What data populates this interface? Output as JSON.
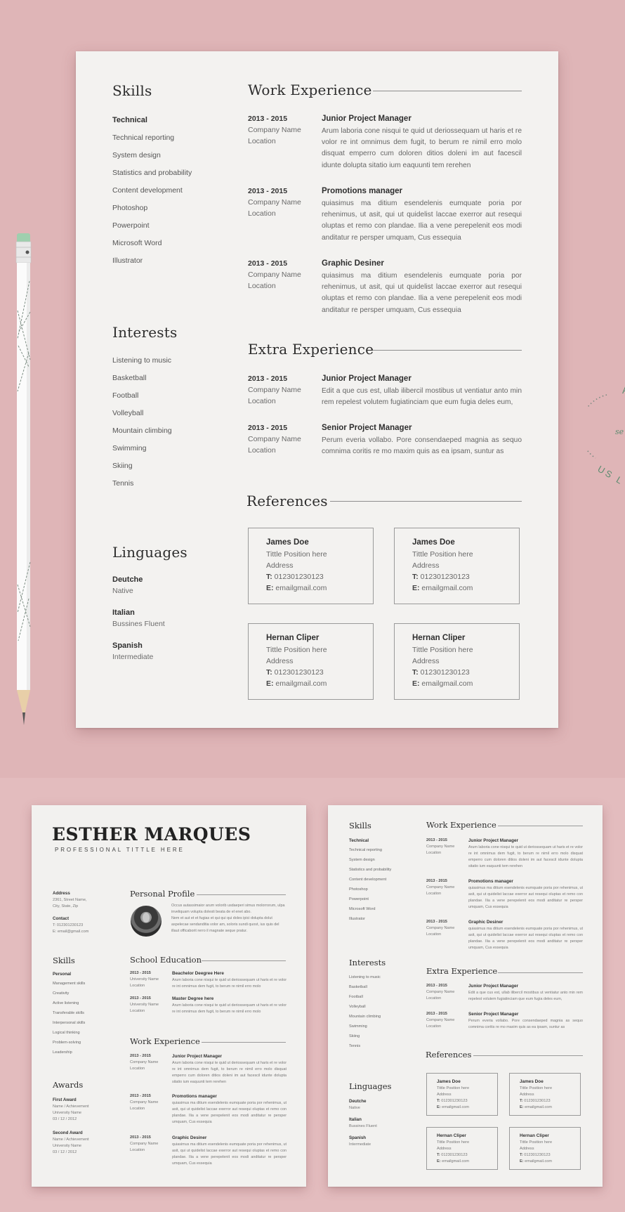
{
  "main_page": {
    "skills": {
      "heading": "Skills",
      "category": "Technical",
      "items": [
        "Technical reporting",
        "System design",
        "Statistics and probability",
        "Content development",
        "Photoshop",
        "Powerpoint",
        "Microsoft Word",
        "Illustrator"
      ]
    },
    "interests": {
      "heading": "Interests",
      "items": [
        "Listening to music",
        "Basketball",
        "Football",
        "Volleyball",
        "Mountain climbing",
        "Swimming",
        "Skiing",
        "Tennis"
      ]
    },
    "languages": {
      "heading": "Linguages",
      "items": [
        {
          "name": "Deutche",
          "level": "Native"
        },
        {
          "name": "Italian",
          "level": "Bussines Fluent"
        },
        {
          "name": "Spanish",
          "level": "Intermediate"
        }
      ]
    },
    "work_experience": {
      "heading": "Work Experience",
      "jobs": [
        {
          "date": "2013 - 2015",
          "company": "Company Name",
          "location": "Location",
          "title": "Junior Project Manager",
          "description": "Arum laboria cone nisqui te quid ut deriossequam ut haris et re volor re int omnimus dem fugit, to berum re nimil erro molo disquat emperro cum doloren ditios doleni im aut facescil idunte dolupta sitatio ium eaquunti tem rerehen"
        },
        {
          "date": "2013 - 2015",
          "company": "Company Name",
          "location": "Location",
          "title": "Promotions manager",
          "description": "quiasimus ma ditium esendelenis eumquate poria por rehenimus, ut asit, qui ut quidelist laccae exerror aut resequi oluptas et remo con plandae. Ilia a vene perepelenit eos modi anditatur re persper umquam, Cus essequia"
        },
        {
          "date": "2013 - 2015",
          "company": "Company Name",
          "location": "Location",
          "title": "Graphic Desiner",
          "description": "quiasimus ma ditium esendelenis eumquate poria por rehenimus, ut asit, qui ut quidelist laccae exerror aut resequi oluptas et remo con plandae. Ilia a vene perepelenit eos modi anditatur re persper umquam, Cus essequia"
        }
      ]
    },
    "extra_experience": {
      "heading": "Extra Experience",
      "jobs": [
        {
          "date": "2013 - 2015",
          "company": "Company Name",
          "location": "Location",
          "title": "Junior Project Manager",
          "description": "Edit a que cus est, ullab ilibercil mostibus ut ventiatur anto min rem repelest volutem fugiatinciam que eum fugia deles eum,"
        },
        {
          "date": "2013 - 2015",
          "company": "Company Name",
          "location": "Location",
          "title": "Senior Project Manager",
          "description": "Perum everia vollabo. Pore consendaeped magnia as sequo comnima coritis re mo maxim quis as ea ipsam, suntur as"
        }
      ]
    },
    "references": {
      "heading": "References",
      "phone_prefix": "T:",
      "email_prefix": "E:",
      "cards": [
        {
          "name": "James Doe",
          "position": "Tittle Position here",
          "address": "Address",
          "phone": "012301230123",
          "email": "emailgmail.com"
        },
        {
          "name": "James Doe",
          "position": "Tittle Position here",
          "address": "Address",
          "phone": "012301230123",
          "email": "emailgmail.com"
        },
        {
          "name": "Hernan Cliper",
          "position": "Tittle Position here",
          "address": "Address",
          "phone": "012301230123",
          "email": "emailgmail.com"
        },
        {
          "name": "Hernan Cliper",
          "position": "Tittle Position here",
          "address": "Address",
          "phone": "012301230123",
          "email": "emailgmail.com"
        }
      ]
    }
  },
  "front_page": {
    "name": "ESTHER MARQUES",
    "professional_title": "PROFESSIONAL TITTLE HERE",
    "address": {
      "label": "Address",
      "lines": [
        "2361, Street Name,",
        "City, State, Zip"
      ]
    },
    "contact": {
      "label": "Contact",
      "phone": "T: 012301230123",
      "email": "E: email@gmail.com"
    },
    "skills": {
      "heading": "Skills",
      "category": "Personal",
      "items": [
        "Management skills",
        "Creativity",
        "Active listening",
        "Transferable skills",
        "Interpersonal skills",
        "Logical thinking",
        "Problem-solving",
        "Leadership"
      ]
    },
    "awards": {
      "heading": "Awards",
      "items": [
        {
          "title": "First Award",
          "achievement": "Name / Achievement",
          "university": "University Name",
          "date": "03 / 12 / 2012"
        },
        {
          "title": "Second Award",
          "achievement": "Name / Achievement",
          "university": "University Name",
          "date": "03 / 12 / 2012"
        }
      ]
    },
    "personal_profile": {
      "heading": "Personal Profile",
      "text_1": "Occus autassimaior arum volorib usdaeperi simus molorrorum, ulpa inveliquam volupta dolesti beata de el enet abo.",
      "text_2": "Nem et aut et et fugias et qui qui qui doles ipici dolupta dolut aspelecae sendanditia volor am, soloris sundi quost, ius quis del illaut officaborit rerro il magnate seque pratur."
    },
    "education": {
      "heading": "School Education",
      "items": [
        {
          "date": "2013 - 2015",
          "school": "University Name",
          "location": "Location",
          "title": "Beachelor Deegree Here",
          "description": "Arum laboria cone nisqui te quid ut deriossequam ut haris et re volor re int omnimus dem fugit, to berum re nimil erro molo"
        },
        {
          "date": "2013 - 2015",
          "school": "University Name",
          "location": "Location",
          "title": "Master Degree here",
          "description": "Arum laboria cone nisqui te quid ut deriossequam ut haris et re volor re int omnimus dem fugit, to berum re nimil erro molo"
        }
      ]
    },
    "work_experience": {
      "heading": "Work Experience",
      "jobs": [
        {
          "date": "2013 - 2015",
          "company": "Company Name",
          "location": "Location",
          "title": "Junior Project Manager",
          "description": "Arum laboria cone nisqui te quid ut deriossequam ut haris et re volor re int omnimus dem fugit, to berum re nimil erro molo disquat emperro cum doloren ditios doleni im aut facescil idunte dolupta sitatio ium eaquunti tem rerehen"
        },
        {
          "date": "2013 - 2015",
          "company": "Company Name",
          "location": "Location",
          "title": "Promotions manager",
          "description": "quiasimus ma ditium esendelenis eumquate poria por rehenimus, ut asit, qui ut quidelist laccae exerror aut resequi oluptas et remo con plandae. Ilia a vene perepelenit eos modi anditatur re persper umquam, Cus essequia"
        },
        {
          "date": "2013 - 2015",
          "company": "Company Name",
          "location": "Location",
          "title": "Graphic Desiner",
          "description": "quiasimus ma ditium esendelenis eumquate poria por rehenimus, ut asit, qui ut quidelist laccae exerror aut resequi oluptas et remo con plandae. Ilia a vene perepelenit eos modi anditatur re persper umquam, Cus essequia"
        }
      ]
    }
  },
  "decor": {
    "stamp_text_visible": "US L",
    "stamp_script_visible": "se",
    "background_color": "#dfb5b7",
    "paper_color": "#f3f2f0",
    "accent_green": "#6d9a80"
  }
}
